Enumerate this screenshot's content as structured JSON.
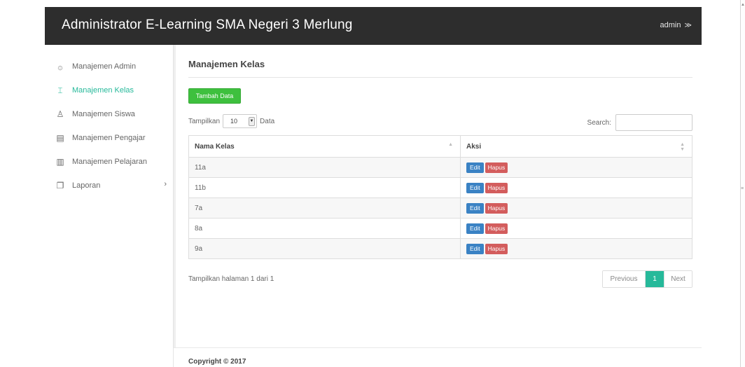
{
  "header": {
    "title": "Administrator E-Learning SMA Negeri 3 Merlung",
    "user_label": "admin",
    "user_chevron": "≫"
  },
  "sidebar": {
    "items": [
      {
        "label": "Manajemen Admin",
        "icon": "settings-icon",
        "glyph": "۞",
        "active": false
      },
      {
        "label": "Manajemen Kelas",
        "icon": "table-icon",
        "glyph": "⌶",
        "active": true
      },
      {
        "label": "Manajemen Siswa",
        "icon": "user-icon",
        "glyph": "♙",
        "active": false
      },
      {
        "label": "Manajemen Pengajar",
        "icon": "id-card-icon",
        "glyph": "▤",
        "active": false
      },
      {
        "label": "Manajemen Pelajaran",
        "icon": "book-icon",
        "glyph": "▥",
        "active": false
      },
      {
        "label": "Laporan",
        "icon": "report-icon",
        "glyph": "❐",
        "active": false,
        "caret": "›"
      }
    ]
  },
  "main": {
    "page_title": "Manajemen Kelas",
    "add_button": "Tambah Data",
    "length_prefix": "Tampilkan",
    "length_value": "10",
    "length_suffix": "Data",
    "search_label": "Search:",
    "search_value": "",
    "table": {
      "columns": [
        "Nama Kelas",
        "Aksi"
      ],
      "rows": [
        {
          "name": "11a"
        },
        {
          "name": "11b"
        },
        {
          "name": "7a"
        },
        {
          "name": "8a"
        },
        {
          "name": "9a"
        }
      ],
      "edit_label": "Edit",
      "delete_label": "Hapus"
    },
    "info": "Tampilkan halaman 1 dari 1",
    "pagination": {
      "previous": "Previous",
      "current": "1",
      "next": "Next"
    }
  },
  "footer": {
    "copyright": "Copyright © 2017"
  },
  "colors": {
    "topbar": "#2d2d2d",
    "accent": "#26b99a",
    "add_button": "#3ec03e",
    "edit_button": "#3a82c4",
    "delete_button": "#d35d5d"
  }
}
